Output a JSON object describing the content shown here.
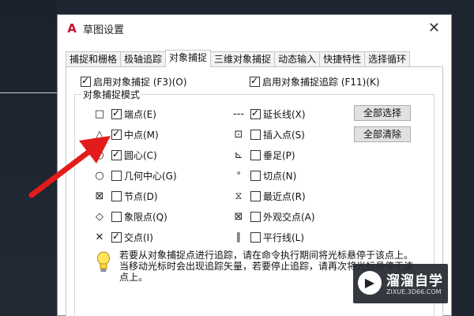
{
  "dialog": {
    "title": "草图设置",
    "app_icon": "A",
    "close": "✕"
  },
  "tabs": [
    {
      "label": "捕捉和栅格",
      "active": false
    },
    {
      "label": "极轴追踪",
      "active": false
    },
    {
      "label": "对象捕捉",
      "active": true
    },
    {
      "label": "三维对象捕捉",
      "active": false
    },
    {
      "label": "动态输入",
      "active": false
    },
    {
      "label": "快捷特性",
      "active": false
    },
    {
      "label": "选择循环",
      "active": false
    }
  ],
  "options": {
    "enable_snap": {
      "label": "启用对象捕捉 (F3)(O)",
      "checked": true
    },
    "enable_tracking": {
      "label": "启用对象捕捉追踪 (F11)(K)",
      "checked": true
    }
  },
  "modes": {
    "group_label": "对象捕捉模式",
    "left": [
      {
        "symbol": "□",
        "label": "端点(E)",
        "checked": true,
        "icon": "endpoint-icon"
      },
      {
        "symbol": "△",
        "label": "中点(M)",
        "checked": true,
        "icon": "midpoint-icon"
      },
      {
        "symbol": "○",
        "label": "圆心(C)",
        "checked": true,
        "icon": "center-icon"
      },
      {
        "symbol": "○",
        "label": "几何中心(G)",
        "checked": false,
        "icon": "geometric-center-icon"
      },
      {
        "symbol": "⊠",
        "label": "节点(D)",
        "checked": false,
        "icon": "node-icon"
      },
      {
        "symbol": "◇",
        "label": "象限点(Q)",
        "checked": false,
        "icon": "quadrant-icon"
      },
      {
        "symbol": "✕",
        "label": "交点(I)",
        "checked": true,
        "icon": "intersection-icon"
      }
    ],
    "right": [
      {
        "symbol": "---",
        "label": "延长线(X)",
        "checked": true,
        "icon": "extension-icon"
      },
      {
        "symbol": "⊡",
        "label": "插入点(S)",
        "checked": false,
        "icon": "insertion-icon"
      },
      {
        "symbol": "⊾",
        "label": "垂足(P)",
        "checked": false,
        "icon": "perpendicular-icon"
      },
      {
        "symbol": "ᐤ",
        "label": "切点(N)",
        "checked": false,
        "icon": "tangent-icon"
      },
      {
        "symbol": "⧖",
        "label": "最近点(R)",
        "checked": false,
        "icon": "nearest-icon"
      },
      {
        "symbol": "⊠",
        "label": "外观交点(A)",
        "checked": false,
        "icon": "apparent-intersection-icon"
      },
      {
        "symbol": "∥",
        "label": "平行线(L)",
        "checked": false,
        "icon": "parallel-icon"
      }
    ]
  },
  "buttons": {
    "select_all": "全部选择",
    "clear_all": "全部清除"
  },
  "tip": "若要从对象捕捉点进行追踪，请在命令执行期间将光标悬停于该点上。当移动光标时会出现追踪矢量，若要停止追踪，请再次将光标悬停于该点上。",
  "watermark": {
    "name": "溜溜自学",
    "url": "ZIXUE.3D66.COM"
  },
  "colors": {
    "arrow": "#e31b1b",
    "background": "#1e2530",
    "logo": "#c8102e"
  }
}
